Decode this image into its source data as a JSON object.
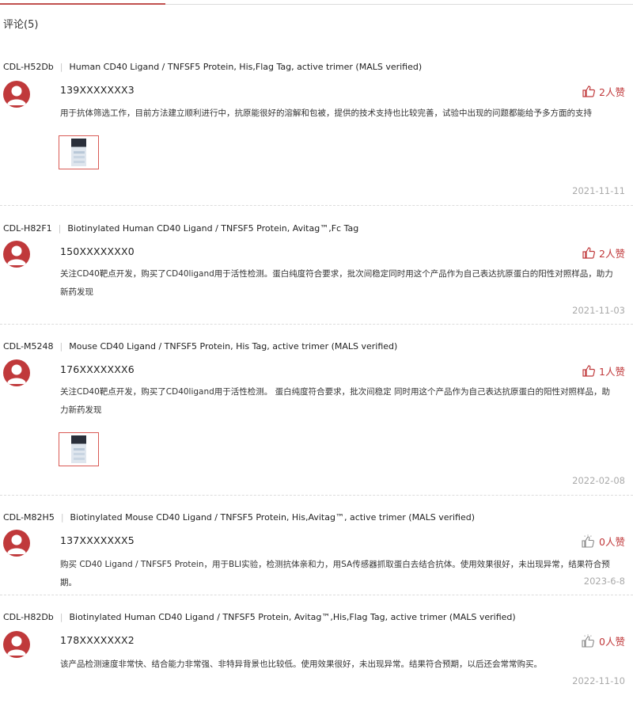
{
  "header": {
    "title": "评论(5)"
  },
  "reviews": [
    {
      "product_code": "CDL-H52Db",
      "product_name": "Human CD40 Ligand / TNFSF5 Protein, His,Flag Tag, active trimer (MALS verified)",
      "user": "139XXXXXXX3",
      "likes": "2人赞",
      "liked": true,
      "text": "用于抗体筛选工作，目前方法建立顺利进行中，抗原能很好的溶解和包被，提供的技术支持也比较完善，试验中出现的问题都能给予多方面的支持",
      "has_image": true,
      "date": "2021-11-11"
    },
    {
      "product_code": "CDL-H82F1",
      "product_name": "Biotinylated Human CD40 Ligand / TNFSF5 Protein, Avitag™,Fc Tag",
      "user": "150XXXXXXX0",
      "likes": "2人赞",
      "liked": true,
      "text": "关注CD40靶点开发，购买了CD40ligand用于活性检测。蛋白纯度符合要求，批次间稳定同时用这个产品作为自己表达抗原蛋白的阳性对照样品，助力新药发现",
      "has_image": false,
      "date": "2021-11-03"
    },
    {
      "product_code": "CDL-M5248",
      "product_name": "Mouse CD40 Ligand / TNFSF5 Protein, His Tag, active trimer (MALS verified)",
      "user": "176XXXXXXX6",
      "likes": "1人赞",
      "liked": true,
      "text": "关注CD40靶点开发，购买了CD40ligand用于活性检测。 蛋白纯度符合要求，批次间稳定 同时用这个产品作为自己表达抗原蛋白的阳性对照样品，助力新药发现",
      "has_image": true,
      "date": "2022-02-08"
    },
    {
      "product_code": "CDL-M82H5",
      "product_name": "Biotinylated Mouse CD40 Ligand / TNFSF5 Protein, His,Avitag™, active trimer (MALS verified)",
      "user": "137XXXXXXX5",
      "likes": "0人赞",
      "liked": false,
      "text": "购买 CD40 Ligand / TNFSF5 Protein，用于BLI实验，检测抗体亲和力，用SA传感器抓取蛋白去结合抗体。使用效果很好，未出现异常，结果符合预期。",
      "has_image": false,
      "date": "2023-6-8"
    },
    {
      "product_code": "CDL-H82Db",
      "product_name": "Biotinylated Human CD40 Ligand / TNFSF5 Protein, Avitag™,His,Flag Tag, active trimer (MALS verified)",
      "user": "178XXXXXXX2",
      "likes": "0人赞",
      "liked": false,
      "text": "该产品检测速度非常快、结合能力非常强、非特异背景也比较低。使用效果很好，未出现异常。结果符合预期，以后还会常常购买。",
      "has_image": false,
      "date": "2022-11-10"
    }
  ]
}
